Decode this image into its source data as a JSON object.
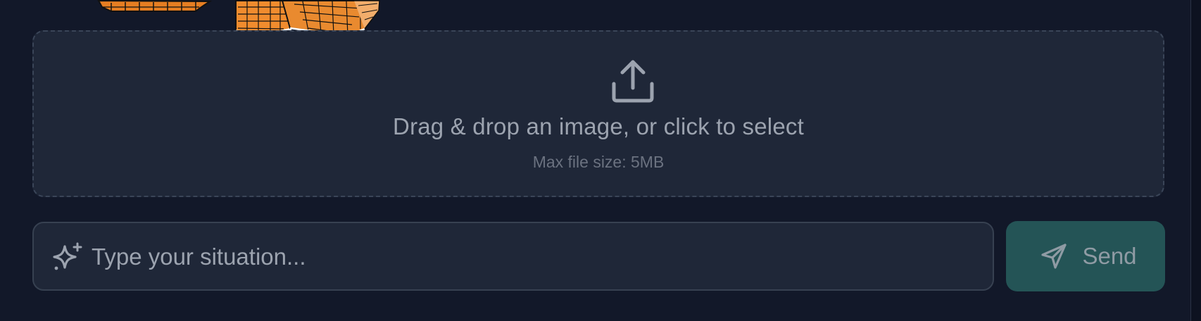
{
  "dropzone": {
    "title": "Drag & drop an image, or click to select",
    "hint": "Max file size: 5MB",
    "icon": "upload-icon"
  },
  "composer": {
    "icon": "sparkles-icon",
    "placeholder": "Type your situation...",
    "value": "",
    "send_label": "Send",
    "send_icon": "paper-plane-icon"
  },
  "colors": {
    "background": "#121829",
    "panel": "#1f2738",
    "border": "#3a4558",
    "accent": "#245456",
    "text": "#9ca3af"
  },
  "preview": {
    "icon": "orange-grid-boxes-image"
  }
}
